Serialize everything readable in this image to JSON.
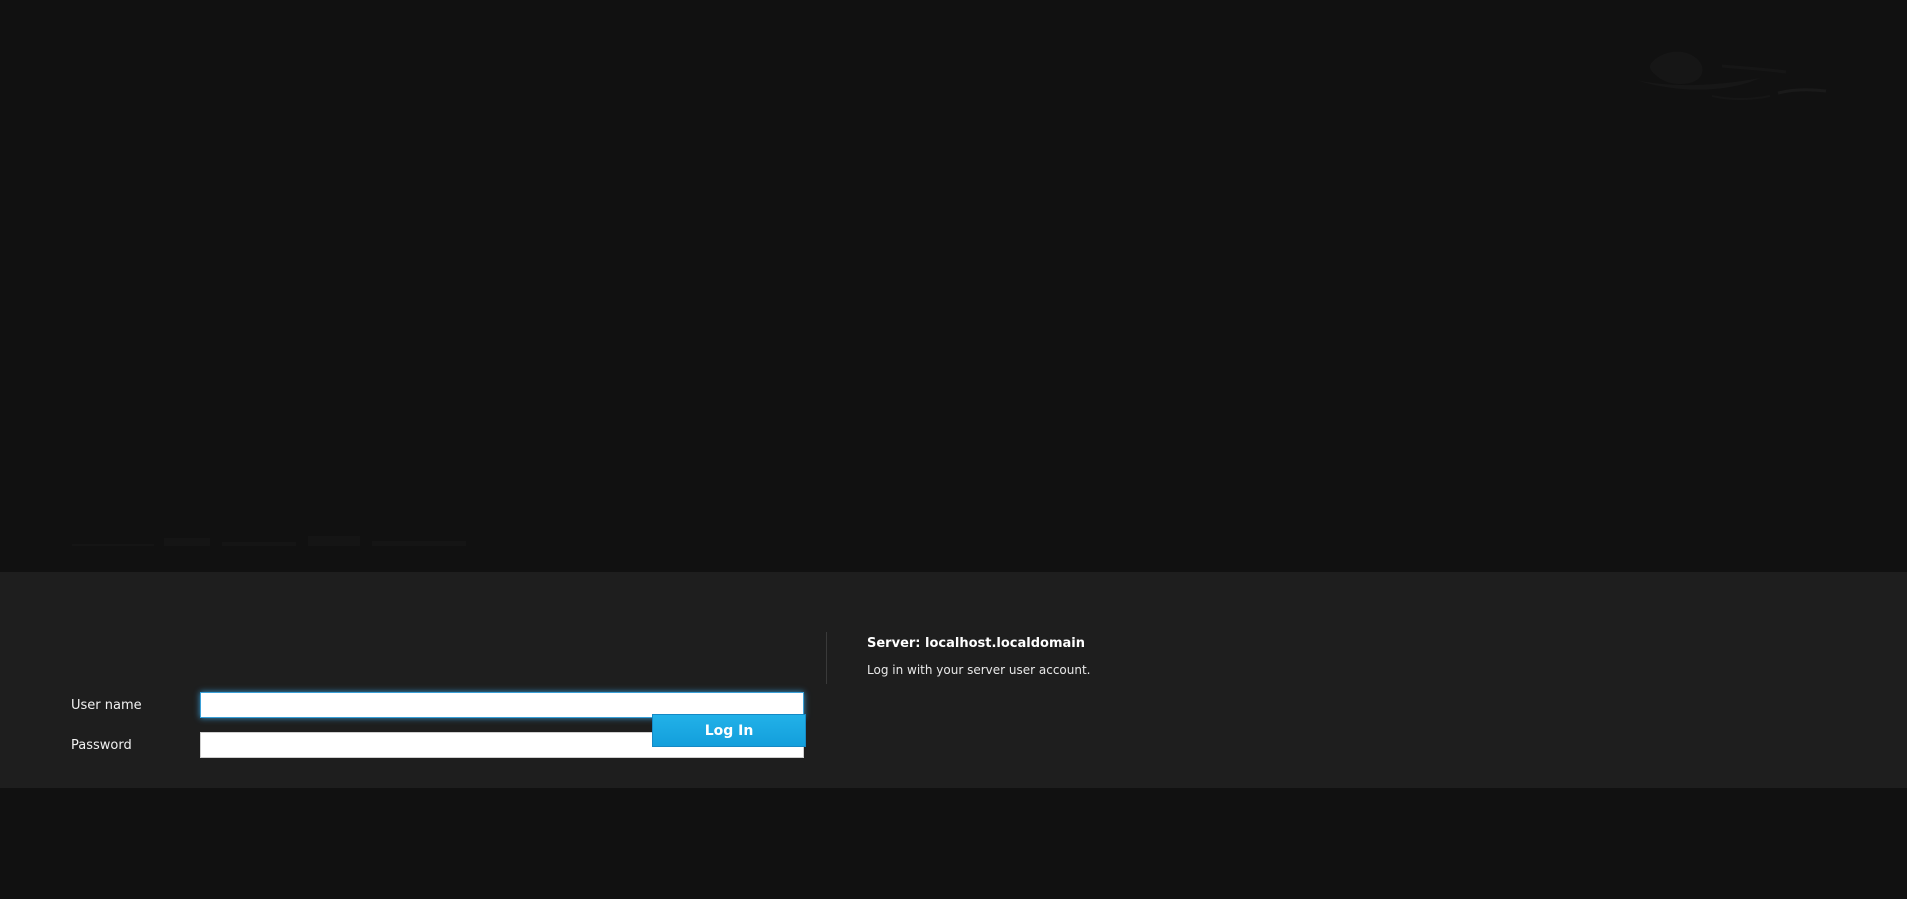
{
  "login": {
    "username_label": "User name",
    "username_value": "",
    "password_label": "Password",
    "password_value": "",
    "login_button_label": "Log In"
  },
  "server": {
    "title": "Server: localhost.localdomain",
    "subtitle": "Log in with your server user account."
  },
  "colors": {
    "background": "#111111",
    "login_band": "#1e1e1e",
    "accent": "#1aa7e1"
  },
  "icons": {
    "brand_logo": "brand-logo-icon",
    "product_wordmark": "product-wordmark-icon"
  }
}
